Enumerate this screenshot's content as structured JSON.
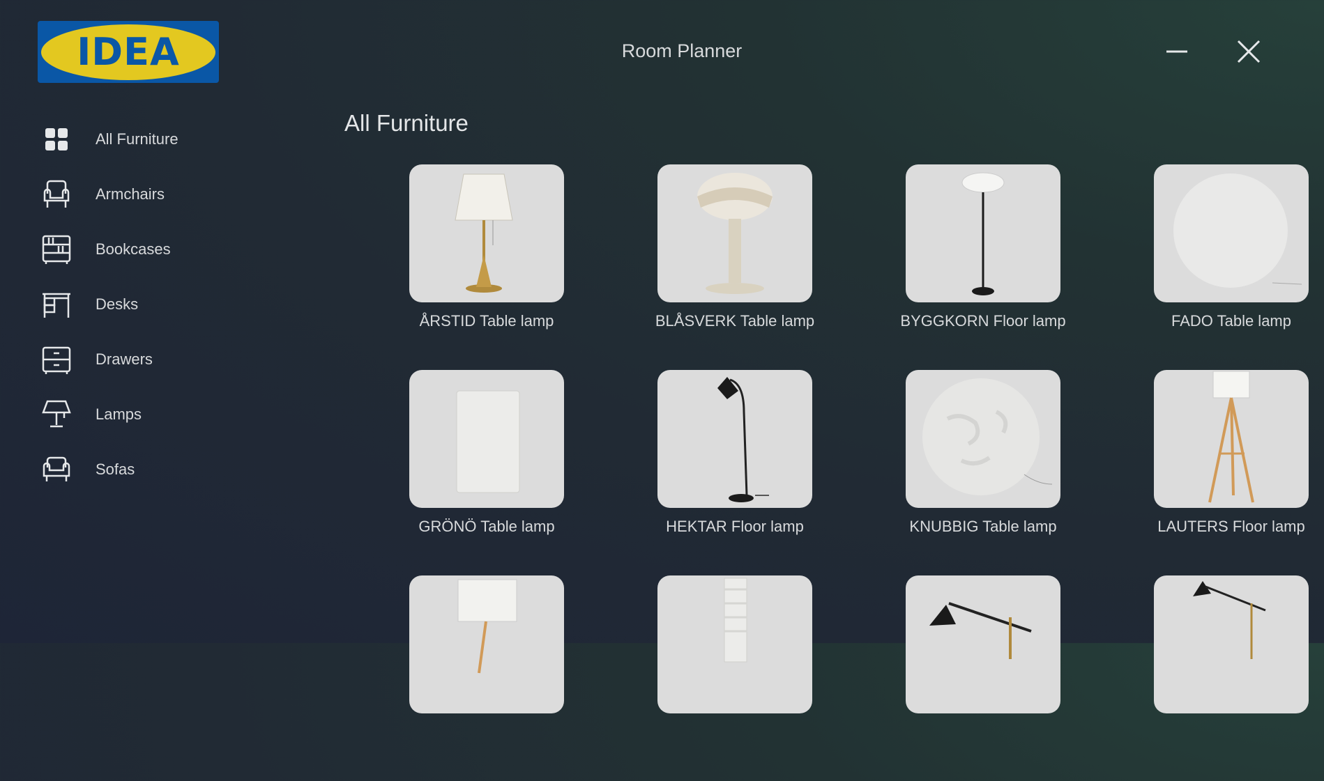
{
  "app": {
    "logo_text": "IDEA",
    "window_title": "Room Planner"
  },
  "sidebar": {
    "items": [
      {
        "label": "All Furniture",
        "icon": "grid-icon"
      },
      {
        "label": "Armchairs",
        "icon": "armchair-icon"
      },
      {
        "label": "Bookcases",
        "icon": "bookcase-icon"
      },
      {
        "label": "Desks",
        "icon": "desk-icon"
      },
      {
        "label": "Drawers",
        "icon": "drawer-icon"
      },
      {
        "label": "Lamps",
        "icon": "lamp-icon"
      },
      {
        "label": "Sofas",
        "icon": "sofa-icon"
      }
    ]
  },
  "main": {
    "section_title": "All Furniture",
    "products": [
      {
        "name": "ÅRSTID Table lamp"
      },
      {
        "name": "BLÅSVERK Table lamp"
      },
      {
        "name": "BYGGKORN Floor lamp"
      },
      {
        "name": "FADO Table lamp"
      },
      {
        "name": "GRÖNÖ Table lamp"
      },
      {
        "name": "HEKTAR Floor lamp"
      },
      {
        "name": "KNUBBIG Table lamp"
      },
      {
        "name": "LAUTERS Floor lamp"
      }
    ]
  },
  "colors": {
    "logo_blue": "#0a57a6",
    "logo_yellow": "#e3c820",
    "thumb_bg": "#dcdcdc"
  }
}
